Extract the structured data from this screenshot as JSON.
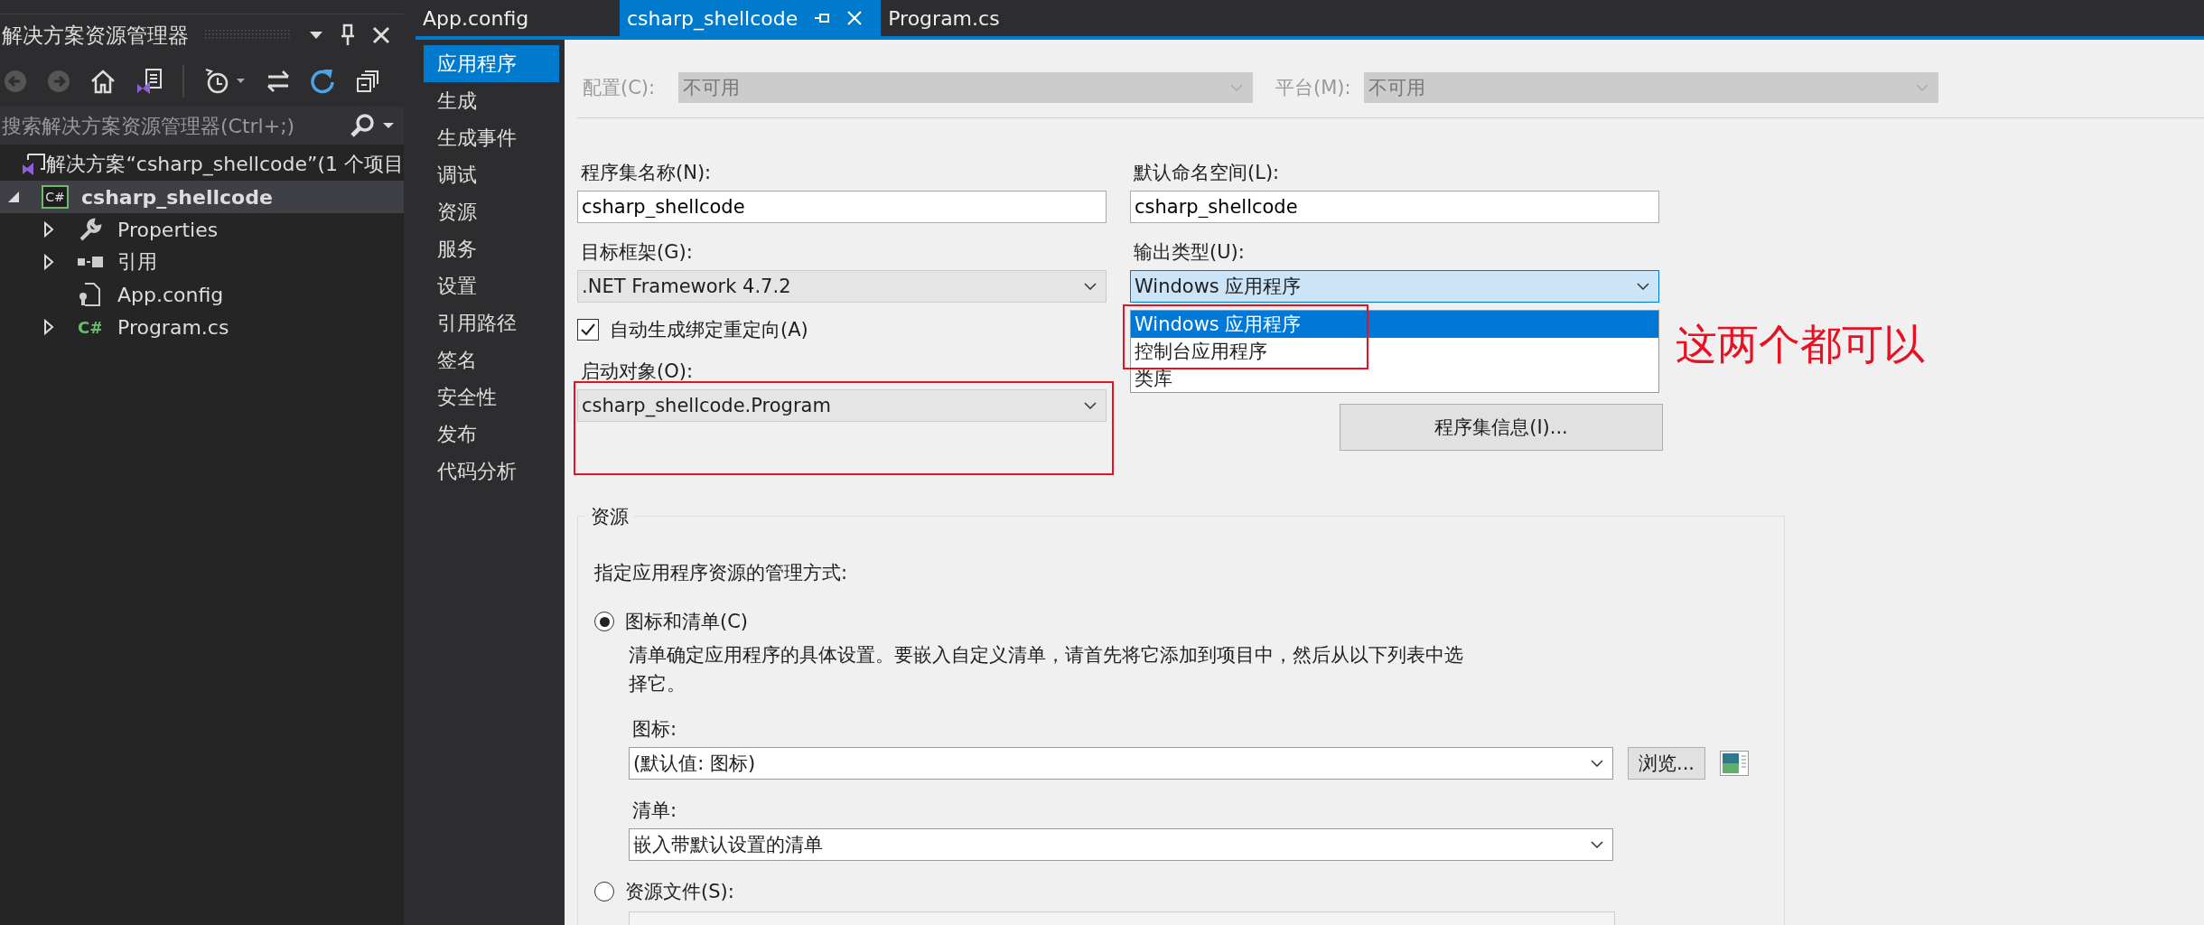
{
  "solution_explorer": {
    "title": "解决方案资源管理器",
    "search": {
      "placeholder": "搜索解决方案资源管理器(Ctrl+;)"
    },
    "tree": [
      {
        "label": "解决方案“csharp_shellcode”(1 个项目",
        "kind": "solution",
        "selected": false,
        "children": [
          {
            "label": "csharp_shellcode",
            "kind": "project",
            "icon_text": "C#",
            "selected": true,
            "expanded": true,
            "children": [
              {
                "label": "Properties",
                "kind": "properties",
                "selected": false,
                "expanded": false
              },
              {
                "label": "引用",
                "kind": "references",
                "selected": false,
                "expanded": false
              },
              {
                "label": "App.config",
                "kind": "config",
                "selected": false
              },
              {
                "label": "Program.cs",
                "kind": "csharp",
                "icon_text": "C#",
                "selected": false,
                "expanded": false
              }
            ]
          }
        ]
      }
    ]
  },
  "tabs": [
    {
      "label": "App.config",
      "selected": false
    },
    {
      "label": "csharp_shellcode",
      "selected": true
    },
    {
      "label": "Program.cs",
      "selected": false
    }
  ],
  "nav": [
    {
      "label": "应用程序",
      "selected": true
    },
    {
      "label": "生成",
      "selected": false
    },
    {
      "label": "生成事件",
      "selected": false
    },
    {
      "label": "调试",
      "selected": false
    },
    {
      "label": "资源",
      "selected": false
    },
    {
      "label": "服务",
      "selected": false
    },
    {
      "label": "设置",
      "selected": false
    },
    {
      "label": "引用路径",
      "selected": false
    },
    {
      "label": "签名",
      "selected": false
    },
    {
      "label": "安全性",
      "selected": false
    },
    {
      "label": "发布",
      "selected": false
    },
    {
      "label": "代码分析",
      "selected": false
    }
  ],
  "config": {
    "label": "配置(C):",
    "value": "不可用",
    "disabled": true
  },
  "platform": {
    "label": "平台(M):",
    "value": "不可用",
    "disabled": true
  },
  "assembly_name": {
    "label": "程序集名称(N):",
    "value": "csharp_shellcode"
  },
  "default_namespace": {
    "label": "默认命名空间(L):",
    "value": "csharp_shellcode"
  },
  "target_framework": {
    "label": "目标框架(G):",
    "value": ".NET Framework 4.7.2"
  },
  "output_type": {
    "label": "输出类型(U):",
    "value": "Windows 应用程序",
    "expanded": true,
    "options": [
      {
        "label": "Windows 应用程序",
        "selected": true
      },
      {
        "label": "控制台应用程序",
        "selected": false
      },
      {
        "label": "类库",
        "selected": false
      }
    ]
  },
  "auto_binding": {
    "label": "自动生成绑定重定向(A)",
    "checked": true
  },
  "startup_object": {
    "label": "启动对象(O):",
    "value": "csharp_shellcode.Program"
  },
  "assembly_info_button": "程序集信息(I)...",
  "resources": {
    "title": "资源",
    "intro": "指定应用程序资源的管理方式:",
    "options": [
      {
        "label": "图标和清单(C)",
        "selected": true
      },
      {
        "label": "资源文件(S):",
        "selected": false
      }
    ],
    "description": "清单确定应用程序的具体设置。要嵌入自定义清单，请首先将它添加到项目中，然后从以下列表中选择它。",
    "icon": {
      "label": "图标:",
      "value": "(默认值: 图标)",
      "browse": "浏览..."
    },
    "manifest": {
      "label": "清单:",
      "value": "嵌入带默认设置的清单"
    }
  },
  "annotation": {
    "text": "这两个都可以"
  }
}
